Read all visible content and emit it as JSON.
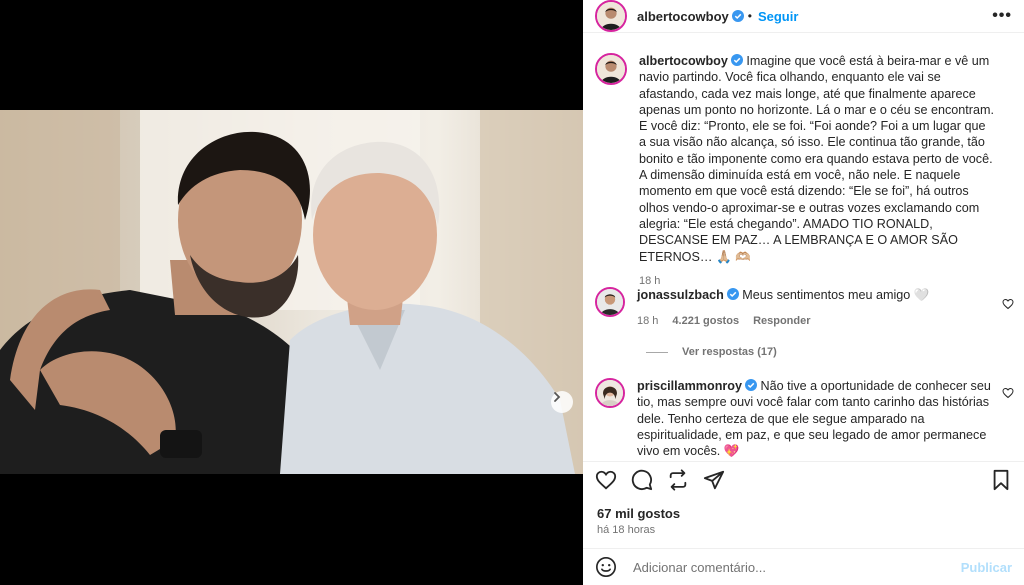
{
  "post": {
    "author": "albertocowboy",
    "follow_label": "Seguir",
    "more_label": "•••",
    "caption_author": "albertocowboy",
    "caption": "Imagine que você está à beira-mar e vê um navio partindo. Você fica olhando, enquanto ele vai se afastando, cada vez mais longe, até que finalmente aparece apenas um ponto no horizonte. Lá o mar e o céu se encontram. E você diz: “Pronto, ele se foi. “Foi aonde? Foi a um lugar que a sua visão não alcança, só isso. Ele continua tão grande, tão bonito e tão imponente como era quando estava perto de você. A dimensão diminuída está em você, não nele. E naquele momento em que você está dizendo: “Ele se foi”, há outros olhos vendo-o aproximar-se e outras vozes exclamando com alegria: “Ele está chegando”. AMADO TIO RONALD, DESCANSE EM PAZ… A LEMBRANÇA E O AMOR SÃO ETERNOS…",
    "caption_emojis": "🙏🏼 🫶🏼",
    "caption_time": "18 h",
    "likes": "67 mil gostos",
    "posted_ago": "há 18 horas"
  },
  "comments": [
    {
      "user": "jonassulzbach",
      "text": "Meus sentimentos meu amigo",
      "emoji": "🤍",
      "time": "18 h",
      "likes": "4.221 gostos",
      "reply_label": "Responder",
      "view_replies": "Ver respostas (17)"
    },
    {
      "user": "priscillammonroy",
      "text": "Não tive a oportunidade de conhecer seu tio, mas sempre ouvi você falar com tanto carinho das histórias dele. Tenho certeza de que ele segue amparado na espiritualidade, em paz, e que seu legado de amor permanece vivo em vocês.",
      "emoji": "💖"
    }
  ],
  "composer": {
    "placeholder": "Adicionar comentário...",
    "publish_label": "Publicar"
  },
  "carousel": {
    "slides": 2,
    "current": 1
  },
  "colors": {
    "accent": "#0095f6",
    "verified": "#3897f0",
    "muted": "#737373"
  },
  "icons": [
    "verified-icon",
    "more-icon",
    "heart-icon",
    "comment-icon",
    "share-icon",
    "send-icon",
    "bookmark-icon",
    "emoji-icon",
    "chevron-right-icon"
  ]
}
